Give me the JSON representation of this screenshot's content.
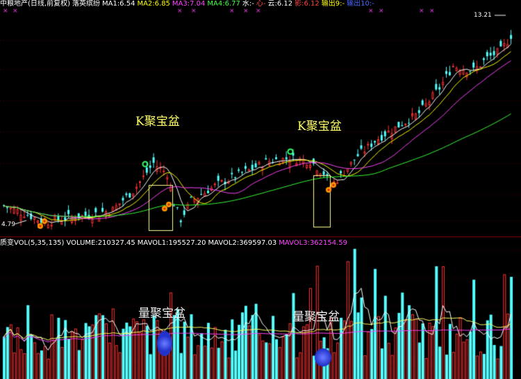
{
  "header": {
    "title": "中粮地产(日线,前复权)",
    "indicator_name": "落英缤纷",
    "items": [
      {
        "label": "MA1:6.54",
        "color": "#ffffff"
      },
      {
        "label": "MA2:6.85",
        "color": "#ffff00"
      },
      {
        "label": "MA3:7.04",
        "color": "#ff44ff"
      },
      {
        "label": "MA4:6.77",
        "color": "#44ff44"
      },
      {
        "label": "水:-",
        "color": "#ffffff"
      },
      {
        "label": "心-",
        "color": "#ff4444"
      },
      {
        "label": "云:6.12",
        "color": "#ffffff"
      },
      {
        "label": "影:6.12",
        "color": "#ff4444"
      },
      {
        "label": "输出9:-",
        "color": "#ffff00"
      },
      {
        "label": "输出10:-",
        "color": "#4466ff"
      }
    ]
  },
  "volume_header": {
    "title": "质变VOL(5,35,135)",
    "items": [
      {
        "label": "VOLUME:210327.45",
        "color": "#ffffff"
      },
      {
        "label": "MAVOL1:195527.20",
        "color": "#ffffff"
      },
      {
        "label": "MAVOL2:369597.03",
        "color": "#ffffff"
      },
      {
        "label": "MAVOL3:362154.59",
        "color": "#ff44ff"
      }
    ]
  },
  "annotations": {
    "k1": "K聚宝盆",
    "k2": "K聚宝盆",
    "v1": "量聚宝盆",
    "v2": "量聚宝盆"
  },
  "price_labels": {
    "high": "13.21",
    "low": "4.79"
  },
  "chart_data": {
    "type": "candlestick",
    "price": {
      "high_label": 13.21,
      "low_label": 4.79,
      "ma_latest": {
        "MA1": 6.54,
        "MA2": 6.85,
        "MA3": 7.04,
        "MA4": 6.77
      }
    },
    "volume": {
      "latest": 210327.45,
      "MAVOL1": 195527.2,
      "MAVOL2": 369597.03,
      "MAVOL3": 362154.59
    },
    "colors": {
      "up": "#ff3333",
      "down": "#54ffff",
      "ma1": "#ffffff",
      "ma2": "#ffff00",
      "ma3": "#ff44ff",
      "ma4": "#33ff33",
      "box": "#ffff99",
      "marker": "#ff9900"
    }
  }
}
